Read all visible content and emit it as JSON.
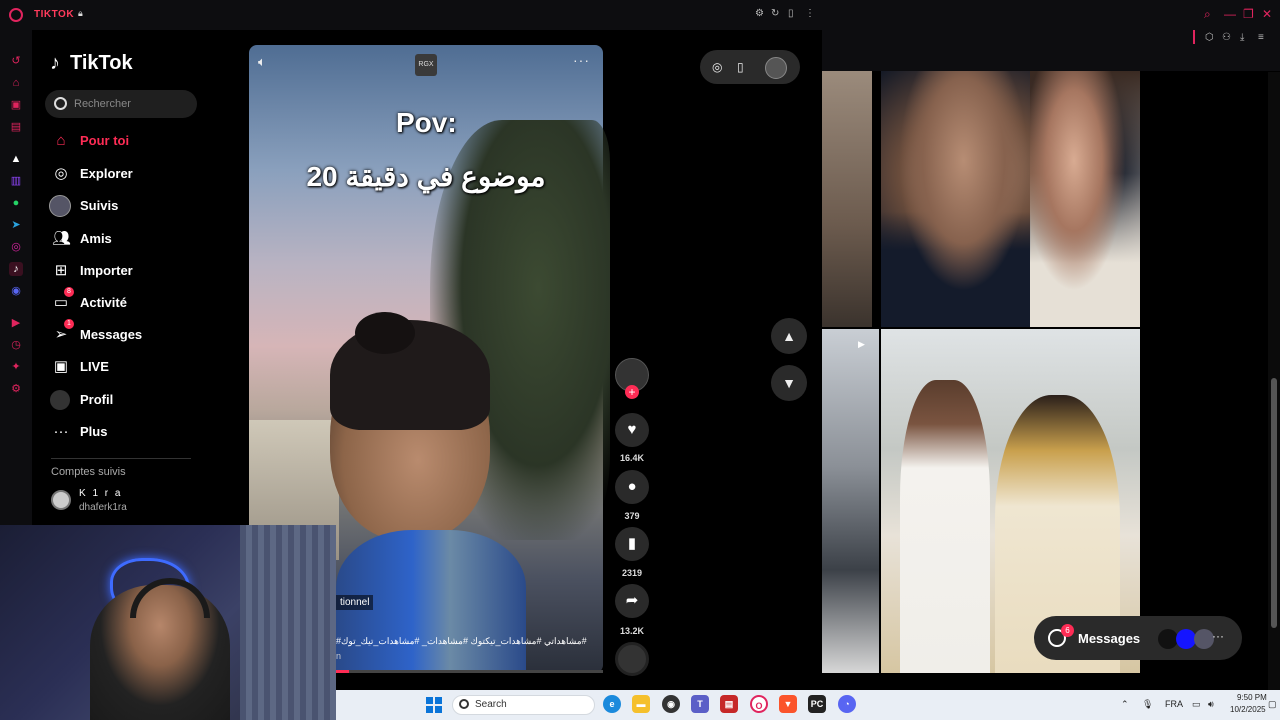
{
  "browser": {
    "tab_title": "TIKTOK",
    "colors": {
      "accent": "#e0245e",
      "tiktok_red": "#fe2c55"
    }
  },
  "tiktok": {
    "logo_text": "TikTok",
    "search_placeholder": "Rechercher",
    "nav": [
      {
        "label": "Pour toi",
        "icon": "home-icon",
        "active": true
      },
      {
        "label": "Explorer",
        "icon": "compass-icon"
      },
      {
        "label": "Suivis",
        "icon": "following-avatar-icon"
      },
      {
        "label": "Amis",
        "icon": "friends-icon"
      },
      {
        "label": "Importer",
        "icon": "upload-icon"
      },
      {
        "label": "Activité",
        "icon": "inbox-icon",
        "badge": "8"
      },
      {
        "label": "Messages",
        "icon": "send-icon",
        "badge": "1"
      },
      {
        "label": "LIVE",
        "icon": "live-tv-icon"
      },
      {
        "label": "Profil",
        "icon": "profile-avatar-icon"
      },
      {
        "label": "Plus",
        "icon": "more-dots-icon"
      }
    ],
    "followed_title": "Comptes suivis",
    "followed_account": {
      "name": "K 1 r a",
      "handle": "dhaferk1ra"
    }
  },
  "video": {
    "badge": "RGX",
    "title": "Pov:",
    "subtitle": "20 موضوع في دقيقة",
    "caption_tag": "tionnel",
    "hashtags": "#مشاهداتي #مشاهدات_تيكتوك #مشاهدات_ #مشاهدات_تيك_توك#",
    "caption_more": "n",
    "progress_fraction": 0.05
  },
  "actions": {
    "likes": "16.4K",
    "comments": "379",
    "saves": "2319",
    "shares": "13.2K"
  },
  "right_pane": {
    "messages_label": "Messages",
    "messages_badge": "6"
  },
  "taskbar": {
    "search_label": "Search",
    "language": "FRA",
    "time": "9:50 PM",
    "date": "10/2/2025"
  }
}
